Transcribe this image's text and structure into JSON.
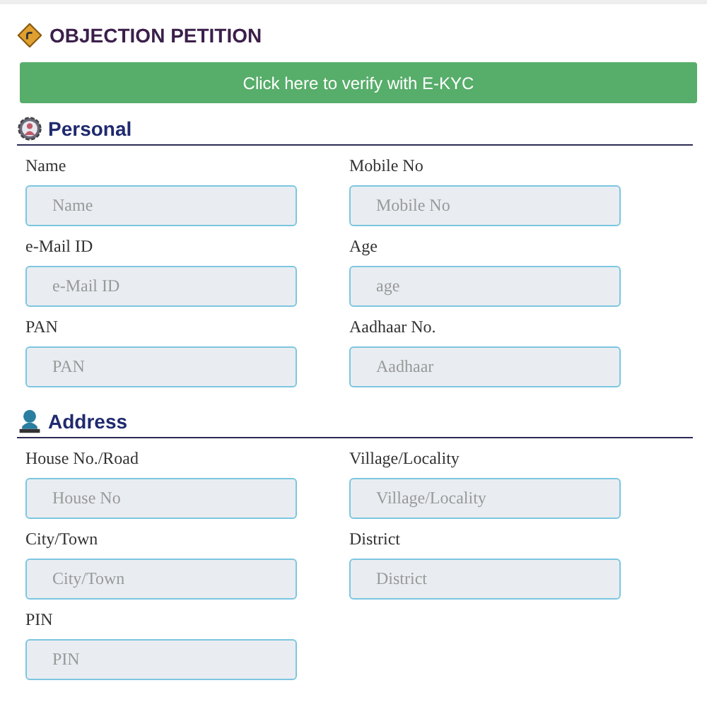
{
  "title": "OBJECTION PETITION",
  "ekyc_button": "Click here to verify with E-KYC",
  "sections": [
    {
      "kind": "personal",
      "heading": "Personal",
      "fields": [
        {
          "label": "Name",
          "placeholder": "Name"
        },
        {
          "label": "Mobile No",
          "placeholder": "Mobile No"
        },
        {
          "label": "e-Mail ID",
          "placeholder": "e-Mail ID"
        },
        {
          "label": "Age",
          "placeholder": "age"
        },
        {
          "label": "PAN",
          "placeholder": "PAN"
        },
        {
          "label": "Aadhaar No.",
          "placeholder": "Aadhaar"
        }
      ]
    },
    {
      "kind": "address",
      "heading": "Address",
      "fields": [
        {
          "label": "House No./Road",
          "placeholder": "House No"
        },
        {
          "label": "Village/Locality",
          "placeholder": "Village/Locality"
        },
        {
          "label": "City/Town",
          "placeholder": "City/Town"
        },
        {
          "label": "District",
          "placeholder": "District"
        },
        {
          "label": "PIN",
          "placeholder": "PIN"
        }
      ]
    }
  ]
}
